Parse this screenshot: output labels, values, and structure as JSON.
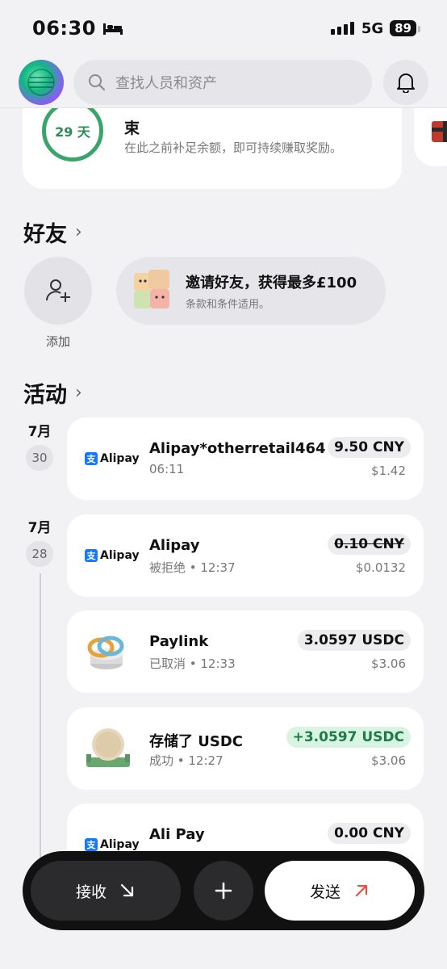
{
  "status_bar": {
    "time": "06:30",
    "network": "5G",
    "battery": "89"
  },
  "search": {
    "placeholder": "查找人员和资产"
  },
  "promo": {
    "countdown": "29 天",
    "title": "束",
    "description": "在此之前补足余额，即可持续赚取奖励。"
  },
  "friends": {
    "title": "好友",
    "add_label": "添加",
    "invite_title": "邀请好友，获得最多£100",
    "invite_sub": "条款和条件适用。"
  },
  "activity": {
    "title": "活动",
    "groups": [
      {
        "month": "7月",
        "day": "30"
      },
      {
        "month": "7月",
        "day": "28"
      }
    ],
    "transactions": [
      {
        "name": "Alipay*otherretail464",
        "sub": "06:11",
        "amount": "9.50 CNY",
        "amount_usd": "$1.42",
        "logo": "Alipay"
      },
      {
        "name": "Alipay",
        "sub": "被拒绝 • 12:37",
        "amount": "0.10 CNY",
        "amount_usd": "$0.0132",
        "logo": "Alipay"
      },
      {
        "name": "Paylink",
        "sub": "已取消 • 12:33",
        "amount": "3.0597 USDC",
        "amount_usd": "$3.06",
        "logo": "coins-icon"
      },
      {
        "name": "存储了 USDC",
        "sub": "成功 • 12:27",
        "amount": "+3.0597 USDC",
        "amount_usd": "$3.06",
        "logo": "coin-stand-icon"
      },
      {
        "name": "Ali Pay",
        "sub": "",
        "amount": "0.00 CNY",
        "amount_usd": "",
        "logo": "Alipay"
      }
    ]
  },
  "actions": {
    "receive": "接收",
    "send": "发送"
  },
  "colors": {
    "positive": "#1e7a48",
    "ring": "#3aa56a",
    "send_arrow": "#e5533c",
    "alipay": "#1677ff"
  }
}
